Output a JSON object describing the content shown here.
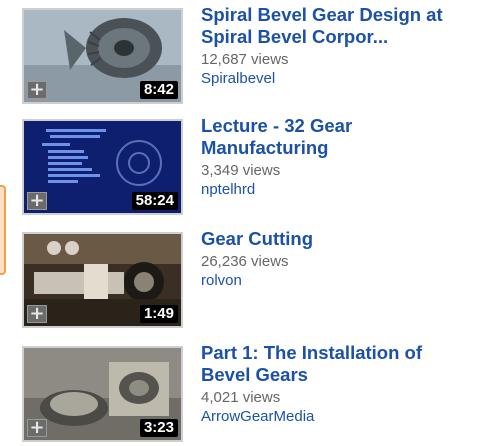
{
  "videos": [
    {
      "title_line1": "Spiral Bevel Gear Design at",
      "title_line2": "Spiral Bevel Corpor...",
      "views": "12,687 views",
      "channel": "Spiralbevel",
      "duration": "8:42",
      "thumb_icon": "gear-icon"
    },
    {
      "title_line1": "Lecture - 32 Gear",
      "title_line2": "Manufacturing",
      "views": "3,349 views",
      "channel": "nptelhrd",
      "duration": "58:24",
      "thumb_icon": "lecture-slide-icon"
    },
    {
      "title_line1": "Gear Cutting",
      "title_line2": "",
      "views": "26,236 views",
      "channel": "rolvon",
      "duration": "1:49",
      "thumb_icon": "machine-icon"
    },
    {
      "title_line1": "Part 1: The Installation of",
      "title_line2": "Bevel Gears",
      "views": "4,021 views",
      "channel": "ArrowGearMedia",
      "duration": "3:23",
      "thumb_icon": "gearbox-icon"
    }
  ],
  "add_button_icon": "plus-icon",
  "colors": {
    "link": "#1c51a8",
    "muted": "#666666",
    "tab_fill": "#fbe0c4",
    "tab_border": "#f0a04b"
  }
}
